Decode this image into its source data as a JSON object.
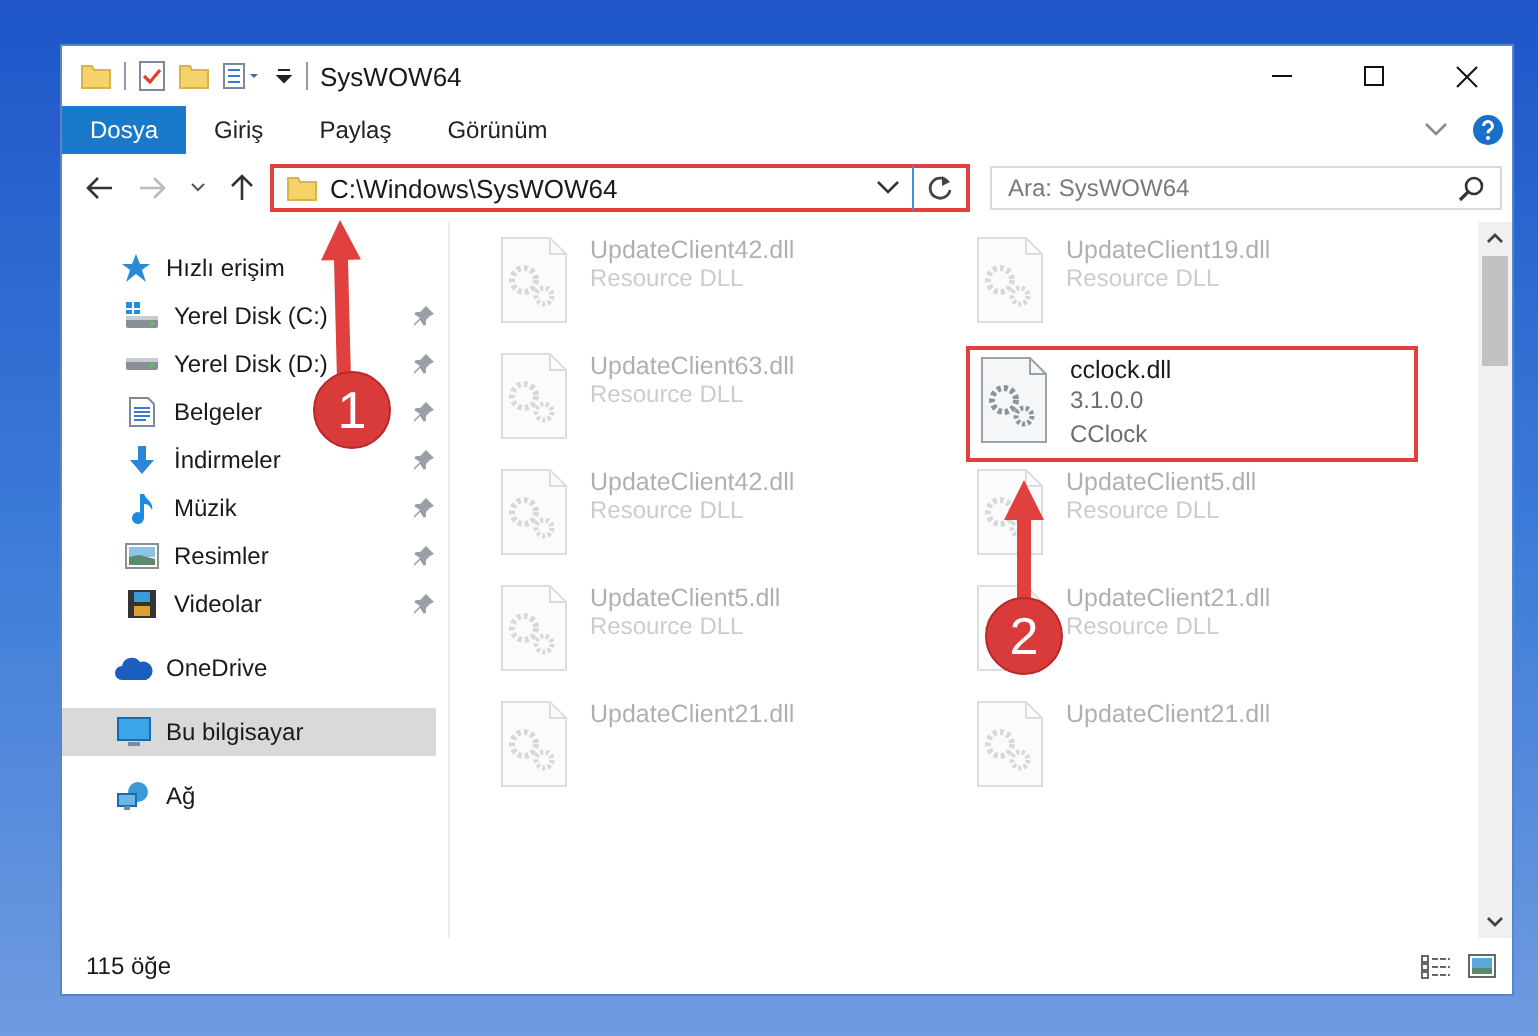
{
  "window": {
    "title": "SysWOW64"
  },
  "ribbon_tabs": [
    {
      "label": "Dosya",
      "selected": true
    },
    {
      "label": "Giriş",
      "selected": false
    },
    {
      "label": "Paylaş",
      "selected": false
    },
    {
      "label": "Görünüm",
      "selected": false
    }
  ],
  "address_bar": {
    "path": "C:\\Windows\\SysWOW64",
    "highlighted": true
  },
  "search": {
    "placeholder": "Ara: SysWOW64"
  },
  "sidebar": {
    "items": [
      {
        "label": "Hızlı erişim",
        "kind": "star",
        "selected": false,
        "children": [
          {
            "label": "Yerel Disk (C:)",
            "kind": "system-drive",
            "selected": false,
            "pinned": true
          },
          {
            "label": "Yerel Disk (D:)",
            "kind": "drive",
            "selected": false,
            "pinned": true
          },
          {
            "label": "Belgeler",
            "kind": "documents",
            "selected": false,
            "pinned": true
          },
          {
            "label": "İndirmeler",
            "kind": "downloads",
            "selected": false,
            "pinned": true
          },
          {
            "label": "Müzik",
            "kind": "music",
            "selected": false,
            "pinned": true
          },
          {
            "label": "Resimler",
            "kind": "pictures",
            "selected": false,
            "pinned": true
          },
          {
            "label": "Videolar",
            "kind": "videos",
            "selected": false,
            "pinned": true
          }
        ]
      },
      {
        "label": "OneDrive",
        "kind": "cloud",
        "selected": false
      },
      {
        "label": "Bu bilgisayar",
        "kind": "computer",
        "selected": true
      },
      {
        "label": "Ağ",
        "kind": "network",
        "selected": false
      }
    ]
  },
  "files": [
    {
      "name": "UpdateClient42.dll",
      "details": [
        "Resource DLL"
      ],
      "blurred": true,
      "highlighted": false
    },
    {
      "name": "UpdateClient19.dll",
      "details": [
        "Resource DLL"
      ],
      "blurred": true,
      "highlighted": false
    },
    {
      "name": "UpdateClient63.dll",
      "details": [
        "Resource DLL"
      ],
      "blurred": true,
      "highlighted": false
    },
    {
      "name": "cclock.dll",
      "details": [
        "3.1.0.0",
        "CClock"
      ],
      "blurred": false,
      "highlighted": true
    },
    {
      "name": "UpdateClient42.dll",
      "details": [
        "Resource DLL"
      ],
      "blurred": true,
      "highlighted": false
    },
    {
      "name": "UpdateClient5.dll",
      "details": [
        "Resource DLL"
      ],
      "blurred": true,
      "highlighted": false
    },
    {
      "name": "UpdateClient5.dll",
      "details": [
        "Resource DLL"
      ],
      "blurred": true,
      "highlighted": false
    },
    {
      "name": "UpdateClient21.dll",
      "details": [
        "Resource DLL"
      ],
      "blurred": true,
      "highlighted": false
    },
    {
      "name": "UpdateClient21.dll",
      "blurred": true,
      "highlighted": false
    },
    {
      "name": "UpdateClient21.dll",
      "blurred": true,
      "highlighted": false
    }
  ],
  "annotations": [
    {
      "number": "1"
    },
    {
      "number": "2"
    }
  ],
  "status_bar": {
    "item_count": "115 öğe"
  }
}
